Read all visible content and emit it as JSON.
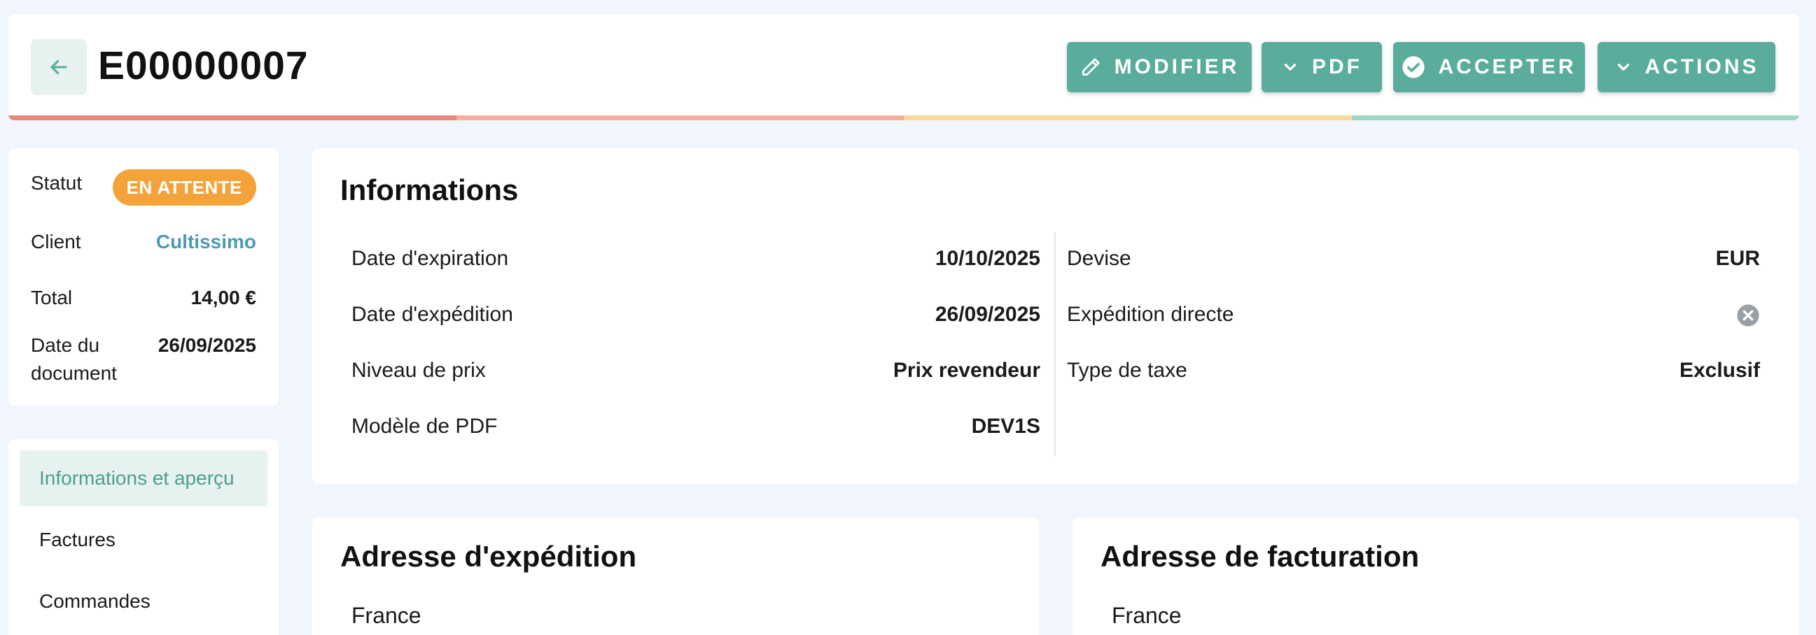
{
  "header": {
    "title": "E00000007",
    "buttons": {
      "modifier": "MODIFIER",
      "pdf": "PDF",
      "accepter": "ACCEPTER",
      "actions": "ACTIONS"
    },
    "progress_colors": [
      "#e9887c",
      "#f4ad9e",
      "#fad999",
      "#9fd5c4"
    ]
  },
  "summary": {
    "statut_label": "Statut",
    "statut_value": "EN ATTENTE",
    "client_label": "Client",
    "client_value": "Cultissimo",
    "total_label": "Total",
    "total_value": "14,00 €",
    "date_label_line1": "Date du",
    "date_label_line2": "document",
    "date_value": "26/09/2025"
  },
  "nav": {
    "items": [
      "Informations et aperçu",
      "Factures",
      "Commandes"
    ]
  },
  "informations": {
    "title": "Informations",
    "left": [
      {
        "label": "Date d'expiration",
        "value": "10/10/2025"
      },
      {
        "label": "Date d'expédition",
        "value": "26/09/2025"
      },
      {
        "label": "Niveau de prix",
        "value": "Prix revendeur"
      },
      {
        "label": "Modèle de PDF",
        "value": "DEV1S"
      }
    ],
    "right": [
      {
        "label": "Devise",
        "value": "EUR"
      },
      {
        "label": "Expédition directe"
      },
      {
        "label": "Type de taxe",
        "value": "Exclusif"
      }
    ]
  },
  "shipping_address": {
    "title": "Adresse d'expédition",
    "country": "France"
  },
  "billing_address": {
    "title": "Adresse de facturation",
    "country": "France"
  },
  "colors": {
    "accent": "#5aac9c",
    "badge_pending": "#f4a33a",
    "client_link": "#4a9bb3",
    "nav_active_bg": "#e6f2ef"
  }
}
